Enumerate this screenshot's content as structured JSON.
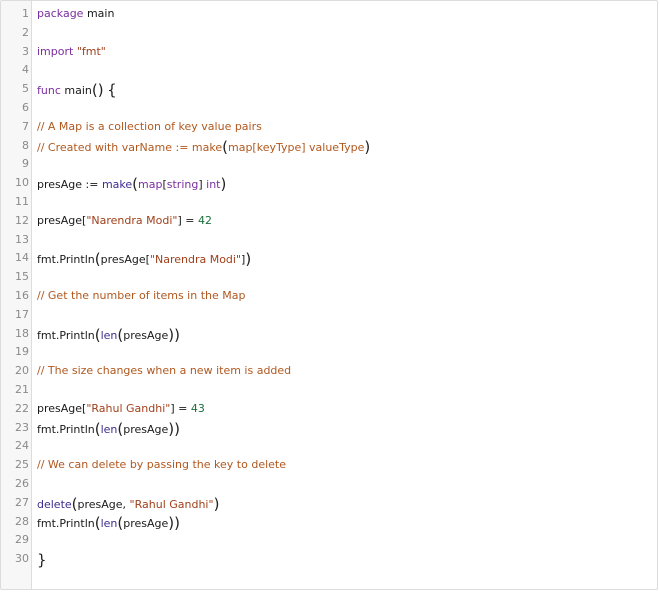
{
  "editor": {
    "lines": [
      {
        "n": "1",
        "tokens": [
          {
            "c": "kw",
            "t": "package"
          },
          {
            "c": "",
            "t": " main"
          }
        ]
      },
      {
        "n": "2",
        "tokens": []
      },
      {
        "n": "3",
        "tokens": [
          {
            "c": "kw",
            "t": "import"
          },
          {
            "c": "",
            "t": " "
          },
          {
            "c": "str",
            "t": "\"fmt\""
          }
        ]
      },
      {
        "n": "4",
        "tokens": []
      },
      {
        "n": "5",
        "tokens": [
          {
            "c": "kw",
            "t": "func"
          },
          {
            "c": "",
            "t": " main"
          },
          {
            "c": "br",
            "t": "()"
          },
          {
            "c": "",
            "t": " "
          },
          {
            "c": "br",
            "t": "{"
          }
        ]
      },
      {
        "n": "6",
        "tokens": []
      },
      {
        "n": "7",
        "tokens": [
          {
            "c": "cm",
            "t": "// A Map is a collection of key value pairs"
          }
        ]
      },
      {
        "n": "8",
        "tokens": [
          {
            "c": "cm",
            "t": "// Created with varName := make"
          },
          {
            "c": "br cm",
            "t": "("
          },
          {
            "c": "cm",
            "t": "map[keyType] valueType"
          },
          {
            "c": "br cm",
            "t": ")"
          }
        ]
      },
      {
        "n": "9",
        "tokens": []
      },
      {
        "n": "10",
        "tokens": [
          {
            "c": "",
            "t": "presAge := "
          },
          {
            "c": "fn",
            "t": "make"
          },
          {
            "c": "br",
            "t": "("
          },
          {
            "c": "kw",
            "t": "map"
          },
          {
            "c": "",
            "t": "["
          },
          {
            "c": "kw",
            "t": "string"
          },
          {
            "c": "",
            "t": "] "
          },
          {
            "c": "kw",
            "t": "int"
          },
          {
            "c": "br",
            "t": ")"
          }
        ]
      },
      {
        "n": "11",
        "tokens": []
      },
      {
        "n": "12",
        "tokens": [
          {
            "c": "",
            "t": "presAge["
          },
          {
            "c": "str",
            "t": "\"Narendra Modi\""
          },
          {
            "c": "",
            "t": "] = "
          },
          {
            "c": "num",
            "t": "42"
          }
        ]
      },
      {
        "n": "13",
        "tokens": []
      },
      {
        "n": "14",
        "tokens": [
          {
            "c": "",
            "t": "fmt.Println"
          },
          {
            "c": "br",
            "t": "("
          },
          {
            "c": "",
            "t": "presAge["
          },
          {
            "c": "str",
            "t": "\"Narendra Modi\""
          },
          {
            "c": "",
            "t": "]"
          },
          {
            "c": "br",
            "t": ")"
          }
        ]
      },
      {
        "n": "15",
        "tokens": []
      },
      {
        "n": "16",
        "tokens": [
          {
            "c": "cm",
            "t": "// Get the number of items in the Map"
          }
        ]
      },
      {
        "n": "17",
        "tokens": []
      },
      {
        "n": "18",
        "tokens": [
          {
            "c": "",
            "t": "fmt.Println"
          },
          {
            "c": "br",
            "t": "("
          },
          {
            "c": "fn",
            "t": "len"
          },
          {
            "c": "br",
            "t": "("
          },
          {
            "c": "",
            "t": "presAge"
          },
          {
            "c": "br",
            "t": "))"
          }
        ]
      },
      {
        "n": "19",
        "tokens": []
      },
      {
        "n": "20",
        "tokens": [
          {
            "c": "cm",
            "t": "// The size changes when a new item is added"
          }
        ]
      },
      {
        "n": "21",
        "tokens": []
      },
      {
        "n": "22",
        "tokens": [
          {
            "c": "",
            "t": "presAge["
          },
          {
            "c": "str",
            "t": "\"Rahul Gandhi\""
          },
          {
            "c": "",
            "t": "] = "
          },
          {
            "c": "num",
            "t": "43"
          }
        ]
      },
      {
        "n": "23",
        "tokens": [
          {
            "c": "",
            "t": "fmt.Println"
          },
          {
            "c": "br",
            "t": "("
          },
          {
            "c": "fn",
            "t": "len"
          },
          {
            "c": "br",
            "t": "("
          },
          {
            "c": "",
            "t": "presAge"
          },
          {
            "c": "br",
            "t": "))"
          }
        ]
      },
      {
        "n": "24",
        "tokens": []
      },
      {
        "n": "25",
        "tokens": [
          {
            "c": "cm",
            "t": "// We can delete by passing the key to delete"
          }
        ]
      },
      {
        "n": "26",
        "tokens": []
      },
      {
        "n": "27",
        "tokens": [
          {
            "c": "fn",
            "t": "delete"
          },
          {
            "c": "br",
            "t": "("
          },
          {
            "c": "",
            "t": "presAge, "
          },
          {
            "c": "str",
            "t": "\"Rahul Gandhi\""
          },
          {
            "c": "br",
            "t": ")"
          }
        ]
      },
      {
        "n": "28",
        "tokens": [
          {
            "c": "",
            "t": "fmt.Println"
          },
          {
            "c": "br",
            "t": "("
          },
          {
            "c": "fn",
            "t": "len"
          },
          {
            "c": "br",
            "t": "("
          },
          {
            "c": "",
            "t": "presAge"
          },
          {
            "c": "br",
            "t": "))"
          }
        ]
      },
      {
        "n": "29",
        "tokens": []
      },
      {
        "n": "30",
        "tokens": [
          {
            "c": "br",
            "t": "}"
          }
        ]
      }
    ]
  },
  "colors": {
    "keyword": "#7a2e9e",
    "string": "#a0401a",
    "number": "#1c6f3c",
    "comment": "#b1581f",
    "builtin": "#3e2b8f",
    "gutter_bg": "#f7f7f7",
    "line_number": "#8a8a8a"
  }
}
